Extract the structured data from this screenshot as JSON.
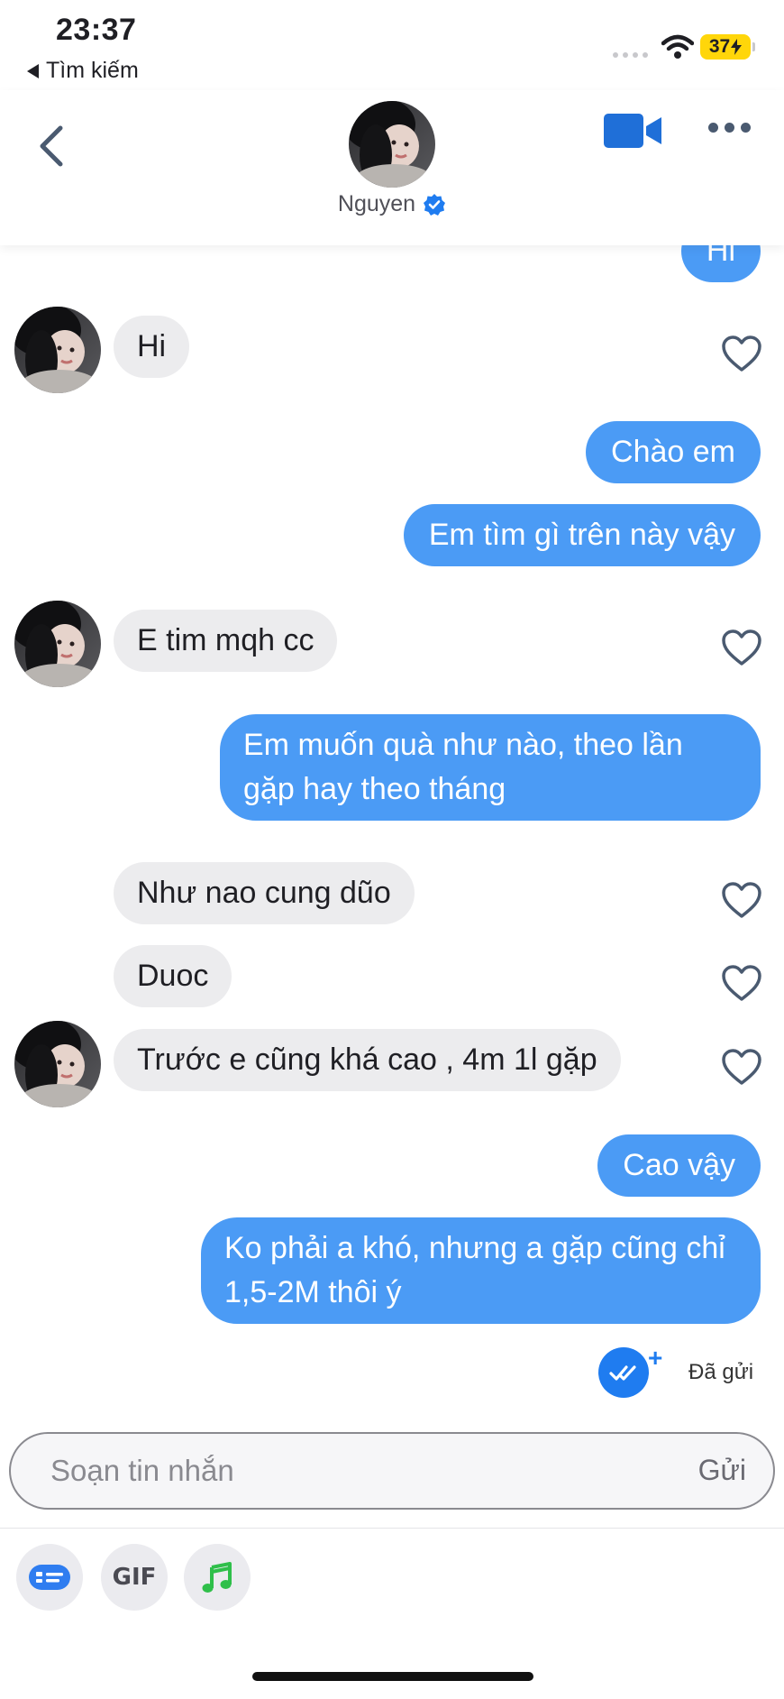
{
  "status_bar": {
    "time": "23:37",
    "back_label": "Tìm kiếm",
    "battery": "37"
  },
  "header": {
    "name": "Nguyen",
    "icons": [
      "back-chevron-icon",
      "verified-badge-icon",
      "video-camera-icon",
      "more-dots-icon"
    ]
  },
  "messages": [
    {
      "dir": "out",
      "text": "Hi"
    },
    {
      "dir": "in",
      "text": "Hi"
    },
    {
      "dir": "out",
      "text": "Chào em"
    },
    {
      "dir": "out",
      "text": "Em tìm gì trên này vậy"
    },
    {
      "dir": "in",
      "text": "E tim mqh cc"
    },
    {
      "dir": "out",
      "text": "Em muốn quà như nào, theo lần gặp hay theo tháng"
    },
    {
      "dir": "in",
      "text": "Như nao cung dũo"
    },
    {
      "dir": "in",
      "text": "Duoc"
    },
    {
      "dir": "in",
      "text": "Trước e cũng khá cao , 4m 1l gặp"
    },
    {
      "dir": "out",
      "text": "Cao vậy"
    },
    {
      "dir": "out",
      "text": "Ko phải a khó, nhưng a gặp cũng chỉ 1,5-2M thôi ý"
    }
  ],
  "delivery": {
    "label": "Đã gửi"
  },
  "composer": {
    "placeholder": "Soạn tin nhắn",
    "send_label": "Gửi"
  },
  "toolbar": {
    "gif_label": "GIF",
    "icons": [
      "sticker-card-icon",
      "gif-icon",
      "music-note-icon"
    ]
  },
  "colors": {
    "outgoing_bubble": "#4b9bf5",
    "incoming_bubble": "#ececee",
    "accent": "#1f7cf0",
    "music": "#2fbf4a",
    "battery": "#ffd60a"
  }
}
